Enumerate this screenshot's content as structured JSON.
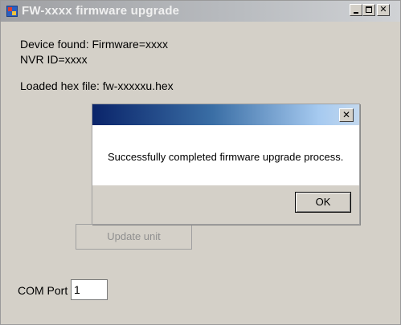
{
  "window": {
    "title": "FW-xxxx firmware upgrade",
    "buttons": {
      "minimize": "",
      "maximize": "",
      "close": "✕"
    }
  },
  "main": {
    "device_found": "Device found: Firmware=xxxx",
    "nvr_id": "NVR ID=xxxx",
    "loaded_hex": "Loaded hex file: fw-xxxxxu.hex",
    "update_button": "Update unit",
    "com_port_label": "COM Port",
    "com_port_value": "1"
  },
  "dialog": {
    "close_label": "✕",
    "message": "Successfully completed firmware upgrade process.",
    "ok_label": "OK"
  }
}
